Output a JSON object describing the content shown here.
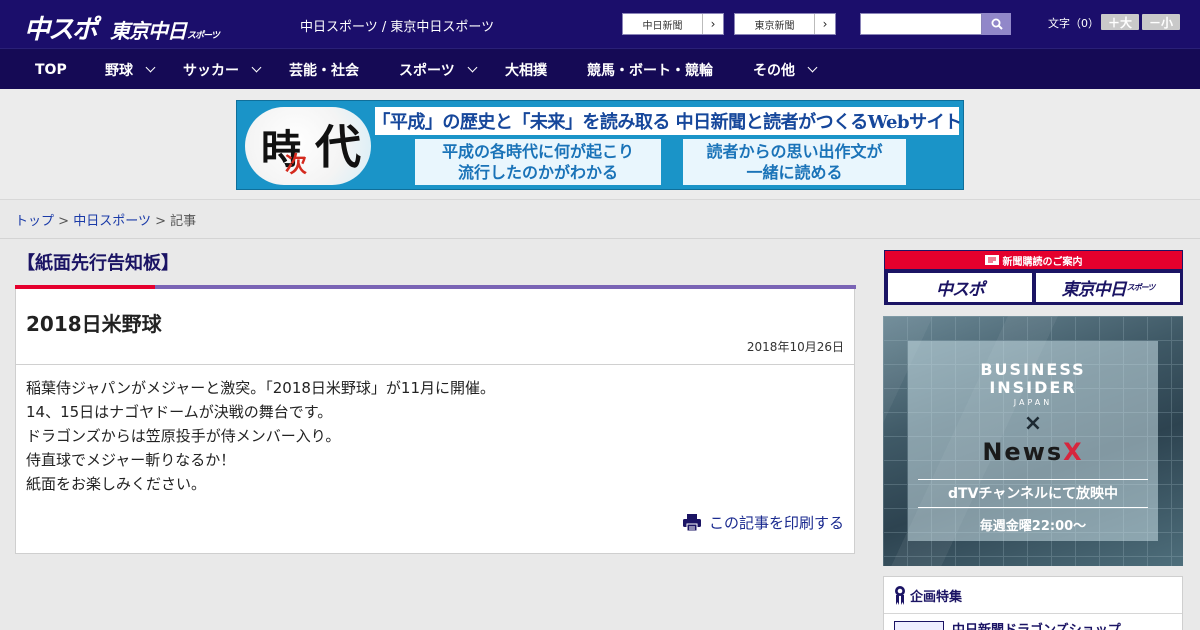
{
  "header": {
    "logo_chuspo": "中スポ",
    "logo_tokyo": "東京中日",
    "logo_tokyo_small": "スポーツ",
    "site_name": "中日スポーツ / 東京中日スポーツ",
    "paper_links": [
      "中日新聞",
      "東京新聞"
    ],
    "search_placeholder": "",
    "font_size_label": "文字（0）",
    "font_plus": "＋大",
    "font_minus": "－小"
  },
  "nav": {
    "items": [
      {
        "label": "TOP",
        "dropdown": false
      },
      {
        "label": "野球",
        "dropdown": true
      },
      {
        "label": "サッカー",
        "dropdown": true
      },
      {
        "label": "芸能・社会",
        "dropdown": false
      },
      {
        "label": "スポーツ",
        "dropdown": true
      },
      {
        "label": "大相撲",
        "dropdown": false
      },
      {
        "label": "競馬・ボート・競輪",
        "dropdown": false
      },
      {
        "label": "その他",
        "dropdown": true
      }
    ]
  },
  "banner": {
    "logo_ji": "時",
    "logo_tsugi": "次",
    "logo_dai": "代",
    "headline": "「平成」の歴史と「未来」を読み取る 中日新聞と読者がつくるWebサイト",
    "box_left": [
      "平成の各時代に何が起こり",
      "流行したのかがわかる"
    ],
    "box_right": [
      "読者からの思い出作文が",
      "一緒に読める"
    ]
  },
  "breadcrumb": {
    "top": "トップ",
    "sep": ">",
    "section": "中日スポーツ",
    "current": "記事"
  },
  "article": {
    "section_title": "【紙面先行告知板】",
    "title": "2018日米野球",
    "date": "2018年10月26日",
    "body": [
      "稲葉侍ジャパンがメジャーと激突。「2018日米野球」が11月に開催。",
      "14、15日はナゴヤドームが決戦の舞台です。",
      "ドラゴンズからは笠原投手が侍メンバー入り。",
      "侍直球でメジャー斬りなるか！",
      "紙面をお楽しみください。"
    ],
    "print_label": "この記事を印刷する"
  },
  "sidebar": {
    "subscription_head": "新聞購読のご案内",
    "sub_chuspo": "中スポ",
    "sub_tokyo": "東京中日",
    "sub_tokyo_small": "スポーツ",
    "ad": {
      "brand_line1": "BUSINESS",
      "brand_line2": "INSIDER",
      "brand_jp": "JAPAN",
      "cross": "×",
      "partner_prefix": "News",
      "partner_suffix": "X",
      "channel": "dTVチャンネルにて放映中",
      "schedule": "毎週金曜22:00〜"
    },
    "feature_title": "企画特集",
    "feature_item": "中日新聞ドラゴンズショップ"
  },
  "colors": {
    "header_bg": "#1b0e6b",
    "nav_bg": "#150a55",
    "accent_red": "#e5002d",
    "accent_purple": "#7a64b5",
    "link_blue": "#1a3aa8"
  }
}
